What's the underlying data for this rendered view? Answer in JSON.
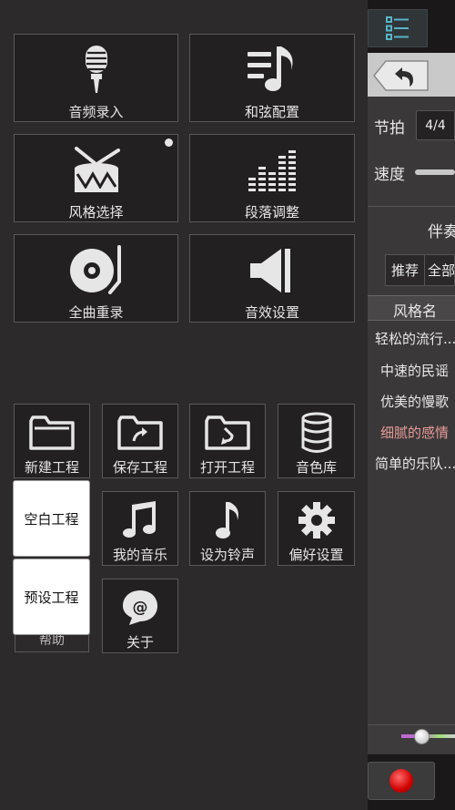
{
  "main_grid": [
    {
      "name": "audio-record-tile",
      "icon": "microphone-icon",
      "label": "音频录入"
    },
    {
      "name": "chord-config-tile",
      "icon": "note-list-icon",
      "label": "和弦配置"
    },
    {
      "name": "style-select-tile",
      "icon": "drum-icon",
      "label": "风格选择",
      "badge": true
    },
    {
      "name": "section-adjust-tile",
      "icon": "equalizer-icon",
      "label": "段落调整"
    },
    {
      "name": "full-rerecord-tile",
      "icon": "turntable-icon",
      "label": "全曲重录"
    },
    {
      "name": "sound-effect-tile",
      "icon": "speaker-icon",
      "label": "音效设置"
    }
  ],
  "project_grid": [
    {
      "name": "new-project-tile",
      "icon": "folder-icon",
      "label": "新建工程"
    },
    {
      "name": "save-project-tile",
      "icon": "folder-save-icon",
      "label": "保存工程"
    },
    {
      "name": "open-project-tile",
      "icon": "folder-open-icon",
      "label": "打开工程"
    },
    {
      "name": "sound-library-tile",
      "icon": "database-icon",
      "label": "音色库"
    },
    {
      "name": "my-music-tile",
      "icon": "music-note-icon",
      "label": "我的音乐"
    },
    {
      "name": "set-ringtone-tile",
      "icon": "eighth-note-icon",
      "label": "设为铃声"
    },
    {
      "name": "preferences-tile",
      "icon": "gear-icon",
      "label": "偏好设置"
    },
    {
      "name": "help-tile",
      "icon": "",
      "label": "帮助"
    },
    {
      "name": "about-tile",
      "icon": "at-icon",
      "label": "关于"
    }
  ],
  "popup": {
    "blank_project": "空白工程",
    "preset_project": "预设工程"
  },
  "right_panel": {
    "beat_label": "节拍",
    "beat_value": "4/4",
    "speed_label": "速度",
    "accompaniment_label": "伴奏",
    "tabs": {
      "recommended": "推荐",
      "all": "全部"
    },
    "list_header": "风格名",
    "styles": [
      {
        "label": "轻松的流行...",
        "selected": false
      },
      {
        "label": "中速的民谣",
        "selected": false
      },
      {
        "label": "优美的慢歌",
        "selected": false
      },
      {
        "label": "细腻的感情",
        "selected": true
      },
      {
        "label": "简单的乐队...",
        "selected": false
      }
    ]
  },
  "colors": {
    "background": "#2d2a2b",
    "tile": "#232021",
    "selected_style": "#e89b98",
    "record": "#d10000"
  }
}
